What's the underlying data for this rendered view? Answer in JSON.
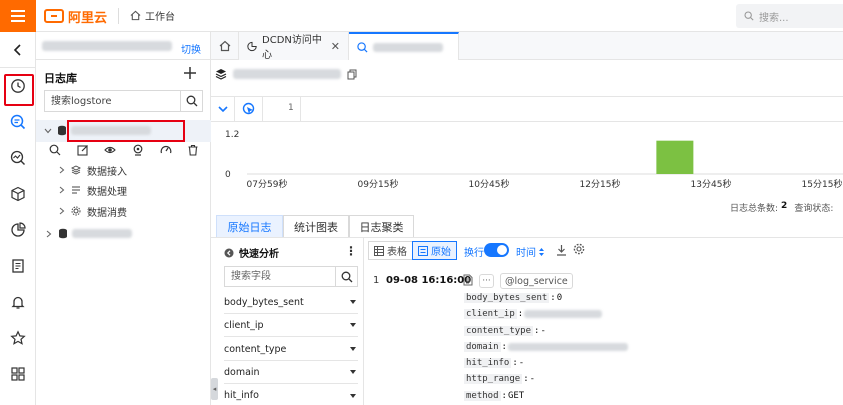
{
  "topbar": {
    "logo_text": "阿里云",
    "workbench_label": "工作台",
    "search_placeholder": "搜索...",
    "brand_color": "#ff6a00"
  },
  "rail": {
    "items": [
      "back-icon",
      "clock-icon",
      "log-search-icon",
      "chart-search-icon",
      "cube-icon",
      "pie-chart-icon",
      "notebook-icon",
      "bell-icon",
      "star-icon",
      "grid-icon"
    ]
  },
  "sidebar": {
    "switch_label": "切换",
    "title": "日志库",
    "search_placeholder": "搜索logstore",
    "sub_items": [
      {
        "label": "数据接入",
        "icon": "layers-icon"
      },
      {
        "label": "数据处理",
        "icon": "list-icon"
      },
      {
        "label": "数据消费",
        "icon": "gear-icon"
      }
    ]
  },
  "tabs": {
    "dcdn_label": "DCDN访问中心"
  },
  "query": {
    "line_number": "1"
  },
  "chart_data": {
    "type": "bar",
    "y_ticks": [
      "1.2",
      "0"
    ],
    "x_ticks": [
      "07分59秒",
      "09分15秒",
      "10分45秒",
      "12分15秒",
      "13分45秒",
      "15分15秒"
    ],
    "ylim": [
      0,
      1.2
    ],
    "bars": [
      {
        "x": "13分15秒",
        "value": 1
      }
    ],
    "bar_color": "#7cc142"
  },
  "summary": {
    "count_label": "日志总条数:",
    "count_value": "2",
    "status_label": "查询状态:"
  },
  "section_tabs": {
    "raw_log": "原始日志",
    "stats_chart": "统计图表",
    "log_cluster": "日志聚类"
  },
  "quick_analysis": {
    "title": "快速分析",
    "more": "⋮",
    "search_placeholder": "搜索字段",
    "fields": [
      "body_bytes_sent",
      "client_ip",
      "content_type",
      "domain",
      "hit_info"
    ]
  },
  "log_toolbar": {
    "table_label": "表格",
    "raw_label": "原始",
    "wrap_label": "换行",
    "time_label": "时间"
  },
  "log_entry": {
    "index": "1",
    "time": "09-08 16:16:00",
    "source_tag": "@log_service",
    "fields": [
      {
        "key": "body_bytes_sent",
        "value": "0"
      },
      {
        "key": "client_ip",
        "value": ""
      },
      {
        "key": "content_type",
        "value": "-"
      },
      {
        "key": "domain",
        "value": ""
      },
      {
        "key": "hit_info",
        "value": "-"
      },
      {
        "key": "http_range",
        "value": "-"
      },
      {
        "key": "method",
        "value": "GET"
      }
    ]
  }
}
